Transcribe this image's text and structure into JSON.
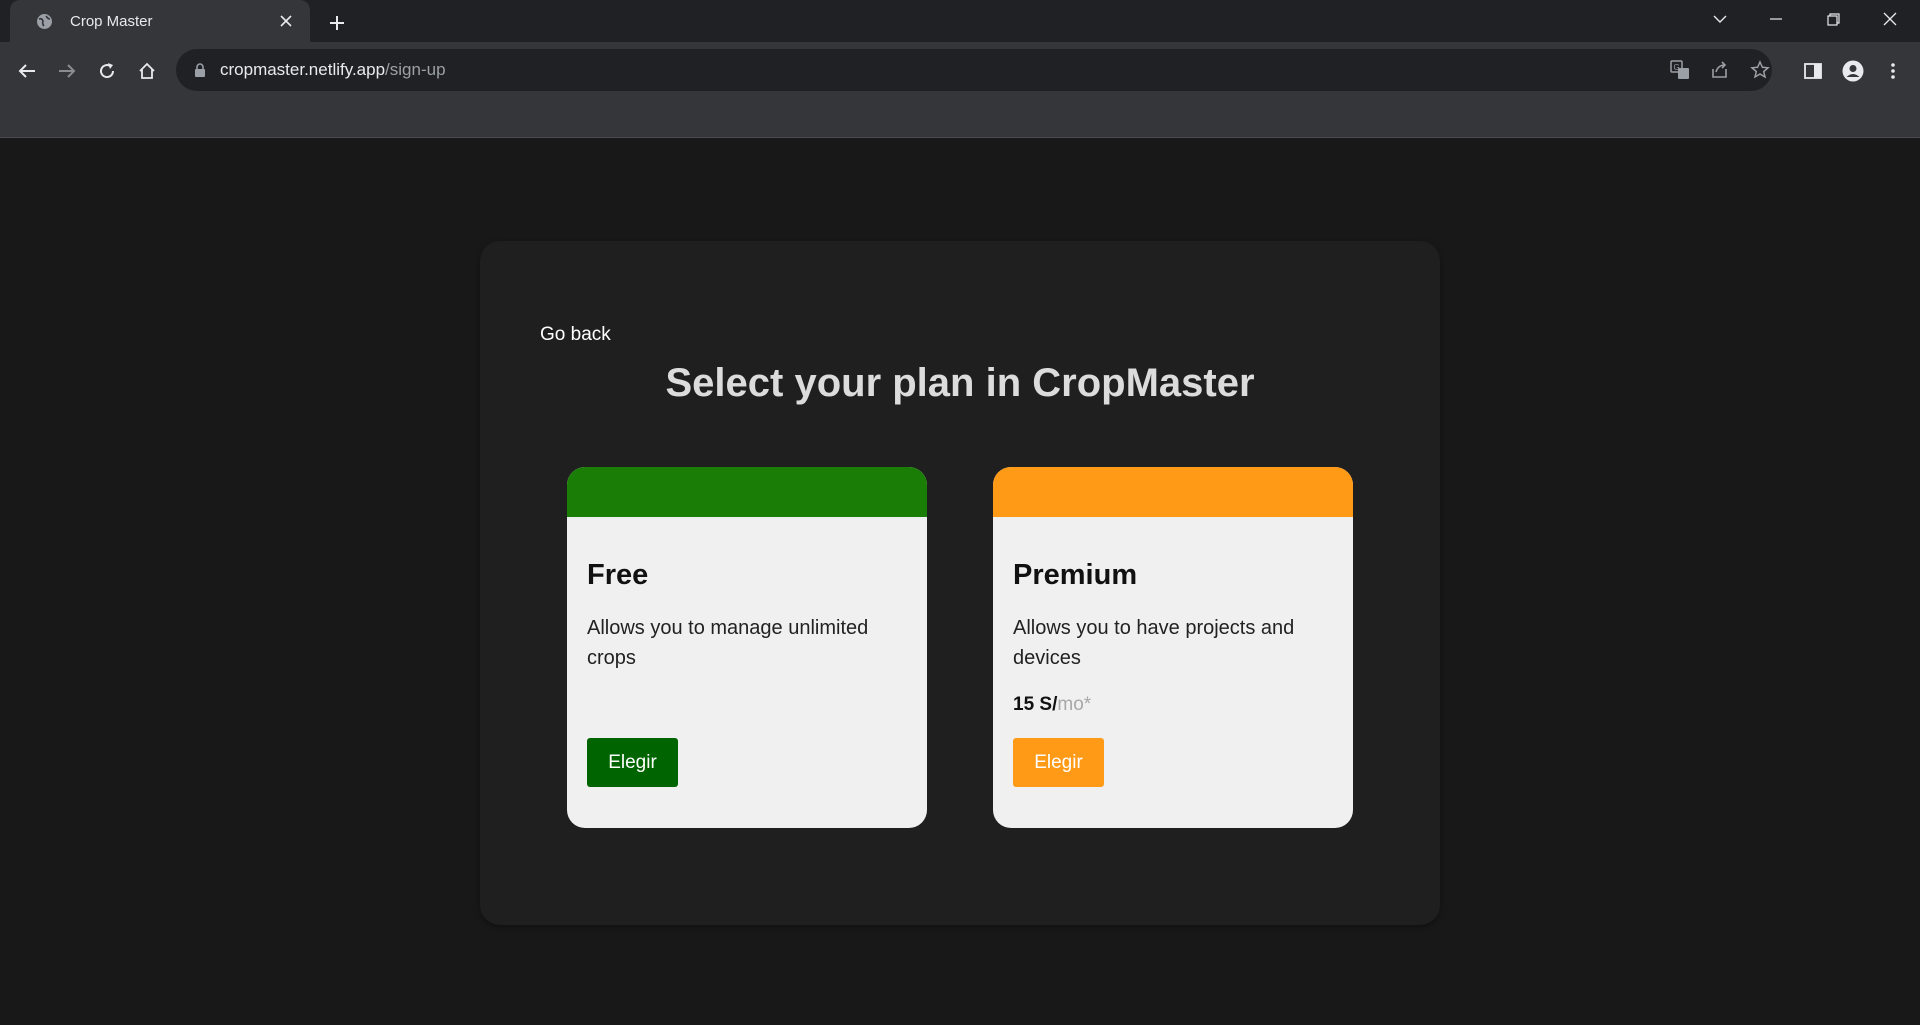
{
  "browser": {
    "tab_title": "Crop Master",
    "url_host": "cropmaster.netlify.app",
    "url_path": "/sign-up"
  },
  "page": {
    "go_back": "Go back",
    "heading": "Select your plan in CropMaster"
  },
  "plans": [
    {
      "name": "Free",
      "description": "Allows you to manage unlimited crops",
      "price_amount": "",
      "price_unit": "",
      "button_label": "Elegir",
      "accent_color": "#1a7d05",
      "button_color": "#006400"
    },
    {
      "name": "Premium",
      "description": "Allows you to have projects and devices",
      "price_amount": "15 S/",
      "price_unit": "mo*",
      "button_label": "Elegir",
      "accent_color": "#ff9a17",
      "button_color": "#ff9a17"
    }
  ],
  "icons": {
    "favicon": "globe-icon",
    "tab_close": "close-icon",
    "new_tab": "plus-icon",
    "back": "arrow-left-icon",
    "forward": "arrow-right-icon",
    "reload": "reload-icon",
    "home": "home-icon",
    "lock": "lock-icon",
    "translate": "translate-icon",
    "share": "share-icon",
    "bookmark": "star-icon",
    "side_panel": "side-panel-icon",
    "profile": "profile-icon",
    "menu": "kebab-menu-icon"
  }
}
